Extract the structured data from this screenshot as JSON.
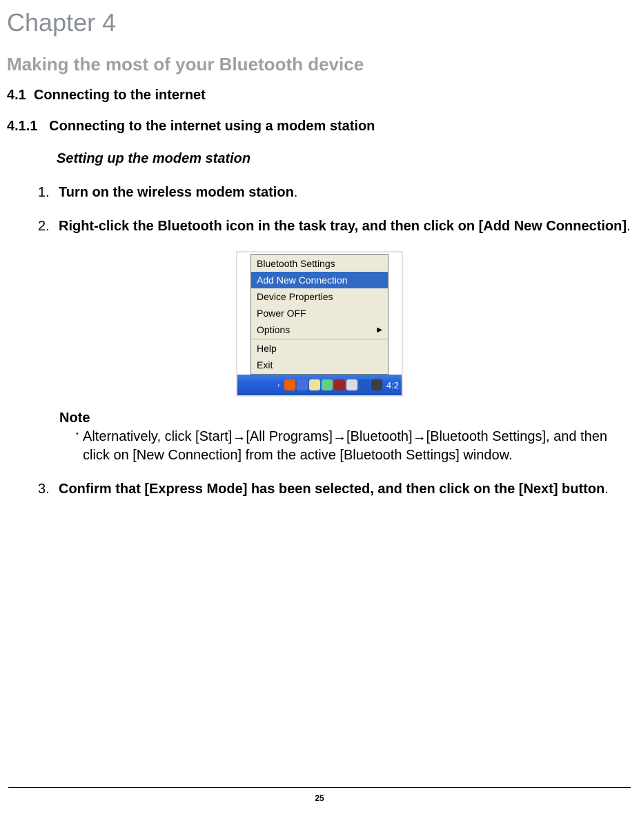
{
  "chapter": {
    "title": "Chapter 4"
  },
  "section": {
    "title": "Making the most of your Bluetooth device"
  },
  "h41": {
    "num": "4.1",
    "title": "Connecting to the internet"
  },
  "h411": {
    "num": "4.1.1",
    "title": "Connecting to the internet using a modem station"
  },
  "sub_italic": "Setting up the modem station",
  "steps": {
    "s1": {
      "num": "1.",
      "bold": "Turn on the wireless modem station",
      "tail": "."
    },
    "s2": {
      "num": "2.",
      "bold": "Right-click the Bluetooth icon in the task tray, and then click on [Add New Connection]",
      "tail": "."
    },
    "s3": {
      "num": "3.",
      "bold": "Confirm that [Express Mode] has been selected, and then click on the [Next] button",
      "tail": "."
    }
  },
  "note": {
    "head": "Note",
    "text": "Alternatively, click [Start]→[All Programs]→[Bluetooth]→[Bluetooth Settings], and then click on [New Connection] from the active [Bluetooth Settings] window."
  },
  "menu": {
    "items": {
      "i0": "Bluetooth Settings",
      "i1": "Add New Connection",
      "i2": "Device Properties",
      "i3": "Power OFF",
      "i4": "Options",
      "i5": "Help",
      "i6": "Exit"
    },
    "selected": "i1"
  },
  "taskbar": {
    "time": "4:2"
  },
  "page_number": "25"
}
